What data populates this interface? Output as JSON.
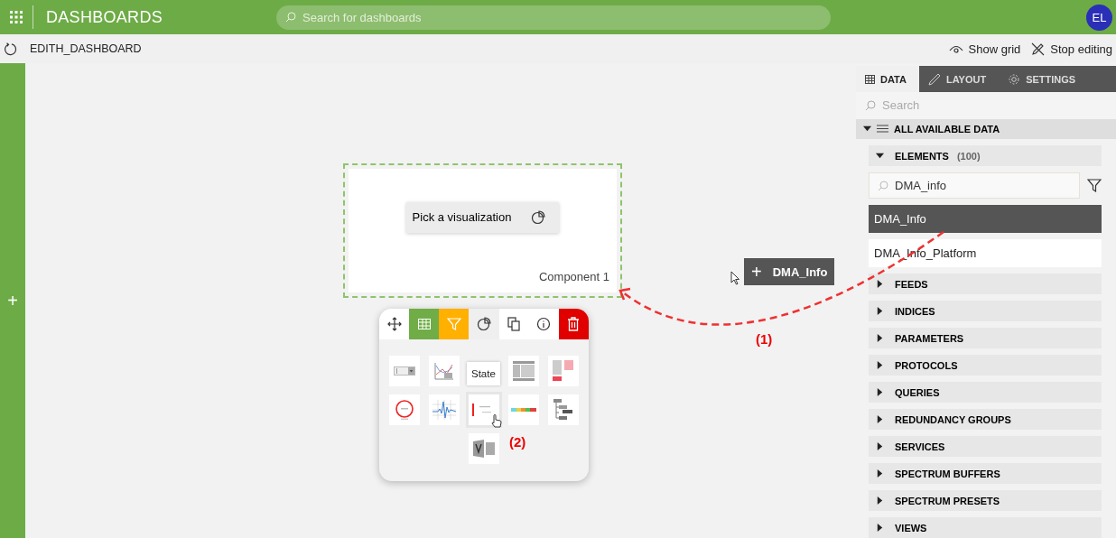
{
  "app": {
    "title": "DASHBOARDS",
    "search_placeholder": "Search for dashboards",
    "user_initials": "EL"
  },
  "toolbar": {
    "dashboard_name": "EDITH_DASHBOARD",
    "actions": [
      {
        "label": "Show grid",
        "kind": "eye"
      },
      {
        "label": "Stop editing",
        "kind": "pencil-off"
      }
    ]
  },
  "side_strip": {
    "add_symbol": "+"
  },
  "component": {
    "button": "Pick a visualization",
    "title": "Component 1"
  },
  "component_tools": [
    {
      "kind": "move",
      "color": "#ffffff"
    },
    {
      "kind": "table",
      "color": "#70ad47"
    },
    {
      "kind": "filter",
      "color": "#ffb000"
    },
    {
      "kind": "pie",
      "color": "#efefef"
    },
    {
      "kind": "copy",
      "color": "#ffffff"
    },
    {
      "kind": "info",
      "color": "#ffffff"
    },
    {
      "kind": "trash",
      "color": "#e00000"
    }
  ],
  "visualizations": [
    [
      {
        "kind": "dropdown"
      },
      {
        "kind": "line-chart"
      },
      {
        "kind": "hidden"
      },
      {
        "kind": "table"
      },
      {
        "kind": "blocks"
      }
    ],
    [
      {
        "kind": "gauge"
      },
      {
        "kind": "spectrum"
      },
      {
        "kind": "state",
        "tooltip": "State"
      },
      {
        "kind": "ruler"
      },
      {
        "kind": "tree"
      }
    ],
    [
      {
        "kind": "visio"
      }
    ]
  ],
  "drag_ghost": {
    "symbol": "+",
    "label": "DMA_Info"
  },
  "annotations": [
    {
      "label": "(1)"
    },
    {
      "label": "(2)"
    }
  ],
  "panel": {
    "tabs": [
      {
        "label": "DATA",
        "kind": "grid",
        "selected": true
      },
      {
        "label": "LAYOUT",
        "kind": "pen",
        "selected": false
      },
      {
        "label": "SETTINGS",
        "kind": "gear",
        "selected": false
      }
    ],
    "search_placeholder": "Search",
    "root": {
      "label": "ALL AVAILABLE DATA",
      "expanded": true,
      "children": [
        {
          "label": "ELEMENTS",
          "count": "(100)",
          "expanded": true,
          "filter_value": "DMA_info",
          "items": [
            {
              "label": "DMA_Info",
              "selected": true
            },
            {
              "label": "DMA_Info_Platform",
              "selected": false
            }
          ]
        },
        {
          "label": "FEEDS",
          "expanded": false
        },
        {
          "label": "INDICES",
          "expanded": false
        },
        {
          "label": "PARAMETERS",
          "expanded": false
        },
        {
          "label": "PROTOCOLS",
          "expanded": false
        },
        {
          "label": "QUERIES",
          "expanded": false
        },
        {
          "label": "REDUNDANCY GROUPS",
          "expanded": false
        },
        {
          "label": "SERVICES",
          "expanded": false
        },
        {
          "label": "SPECTRUM BUFFERS",
          "expanded": false
        },
        {
          "label": "SPECTRUM PRESETS",
          "expanded": false
        },
        {
          "label": "VIEWS",
          "expanded": false
        }
      ]
    }
  }
}
